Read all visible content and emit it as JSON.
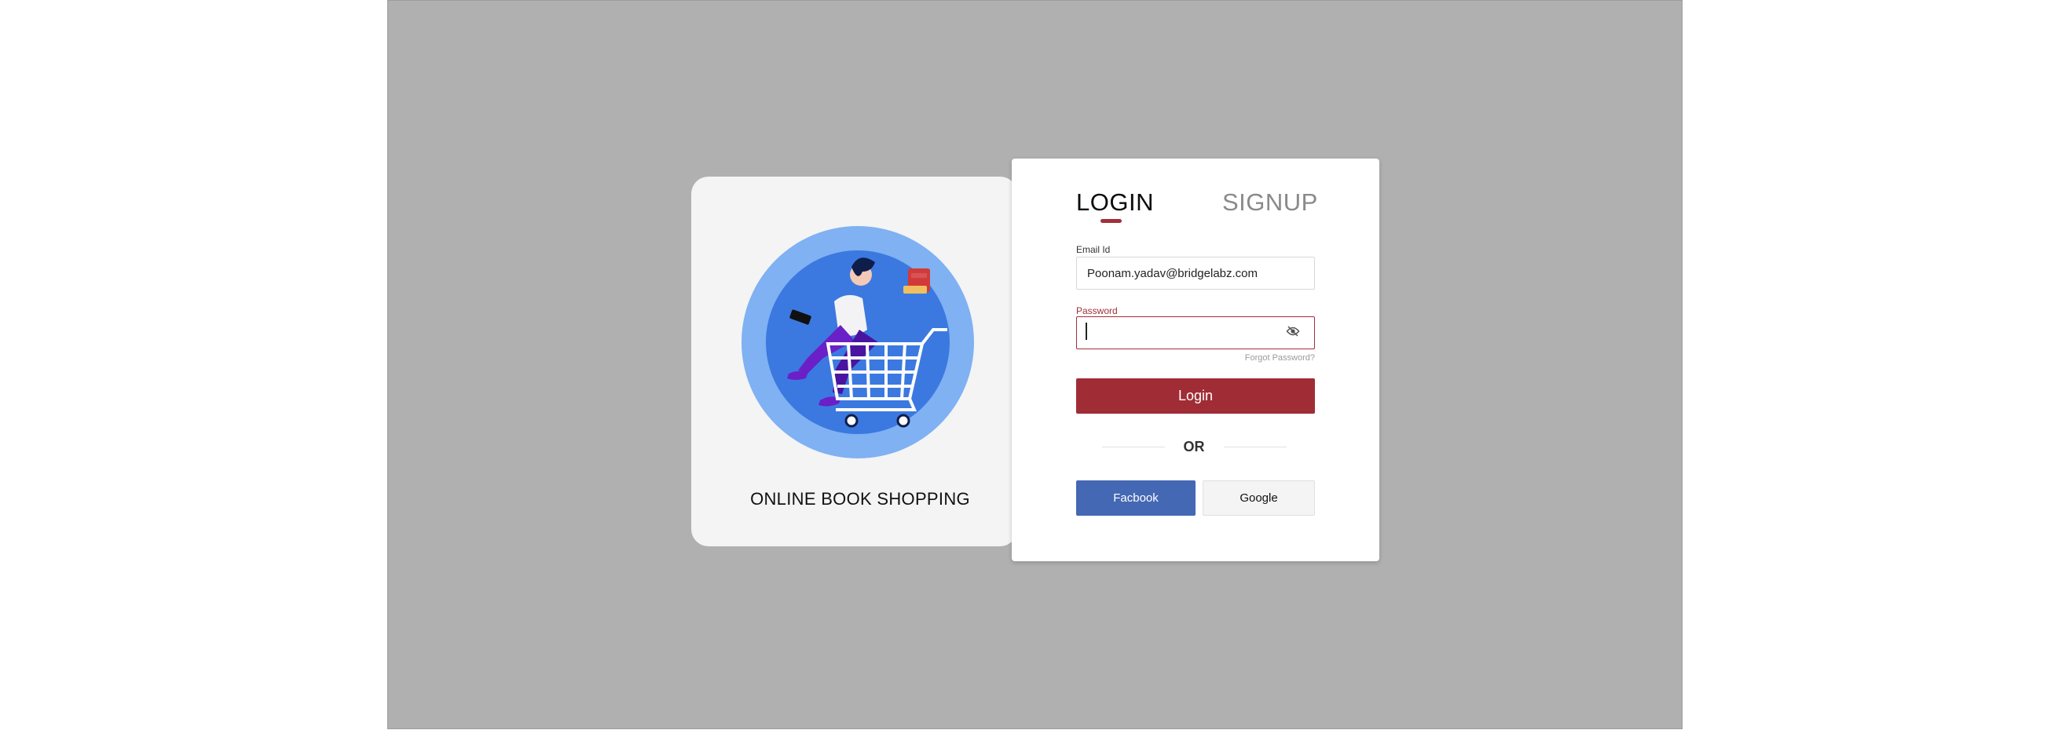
{
  "brand": {
    "title": "ONLINE BOOK SHOPPING"
  },
  "tabs": {
    "login": "LOGIN",
    "signup": "SIGNUP",
    "active": "login"
  },
  "form": {
    "email_label": "Email Id",
    "email_value": "Poonam.yadav@bridgelabz.com",
    "password_label": "Password",
    "password_value": "",
    "password_visibility_icon": "eye-off-icon",
    "forgot_label": "Forgot Password?",
    "login_label": "Login"
  },
  "divider": {
    "text": "OR"
  },
  "social": {
    "facebook_label": "Facbook",
    "google_label": "Google"
  },
  "colors": {
    "accent": "#a02c36",
    "facebook": "#4468b4",
    "backdrop": "#b0b0b0"
  }
}
